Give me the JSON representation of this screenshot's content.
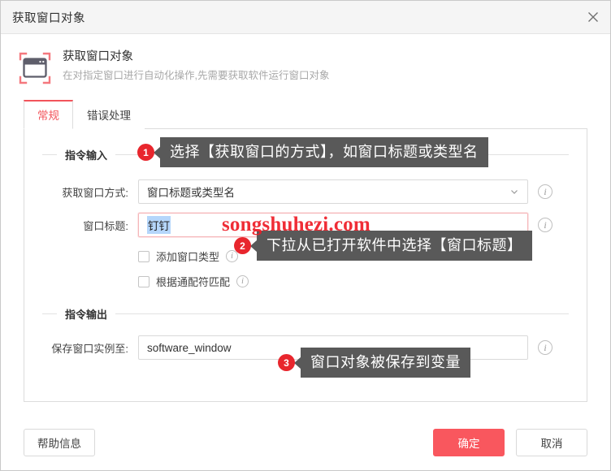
{
  "window": {
    "title": "获取窗口对象",
    "close_icon": "close-icon"
  },
  "header": {
    "icon": "window-capture-icon",
    "title": "获取窗口对象",
    "subtitle": "在对指定窗口进行自动化操作,先需要获取软件运行窗口对象"
  },
  "tabs": [
    {
      "label": "常规",
      "active": true
    },
    {
      "label": "错误处理",
      "active": false
    }
  ],
  "sections": {
    "input": {
      "legend": "指令输入"
    },
    "output": {
      "legend": "指令输出"
    }
  },
  "fields": {
    "method": {
      "label": "获取窗口方式:",
      "value": "窗口标题或类型名",
      "caret_icon": "chevron-down-icon",
      "info_icon": "info-icon"
    },
    "window_title": {
      "label": "窗口标题:",
      "value": "钉钉",
      "info_icon": "info-icon"
    },
    "save_to": {
      "label": "保存窗口实例至:",
      "value": "software_window",
      "info_icon": "info-icon"
    }
  },
  "checkboxes": [
    {
      "label": "添加窗口类型",
      "checked": false,
      "info_icon": "info-icon"
    },
    {
      "label": "根据通配符匹配",
      "checked": false,
      "info_icon": "info-icon"
    }
  ],
  "callouts": [
    {
      "number": "1",
      "text": "选择【获取窗口的方式】，如窗口标题或类型名"
    },
    {
      "number": "2",
      "text": "下拉从已打开软件中选择【窗口标题】"
    },
    {
      "number": "3",
      "text": "窗口对象被保存到变量"
    }
  ],
  "footer": {
    "help": "帮助信息",
    "confirm": "确定",
    "cancel": "取消"
  },
  "watermark": {
    "text": "songshuhezi.com"
  },
  "colors": {
    "accent_red": "#f9575e",
    "badge_red": "#e8262d",
    "bubble_gray": "#595959",
    "tab_active": "#f2545b"
  }
}
